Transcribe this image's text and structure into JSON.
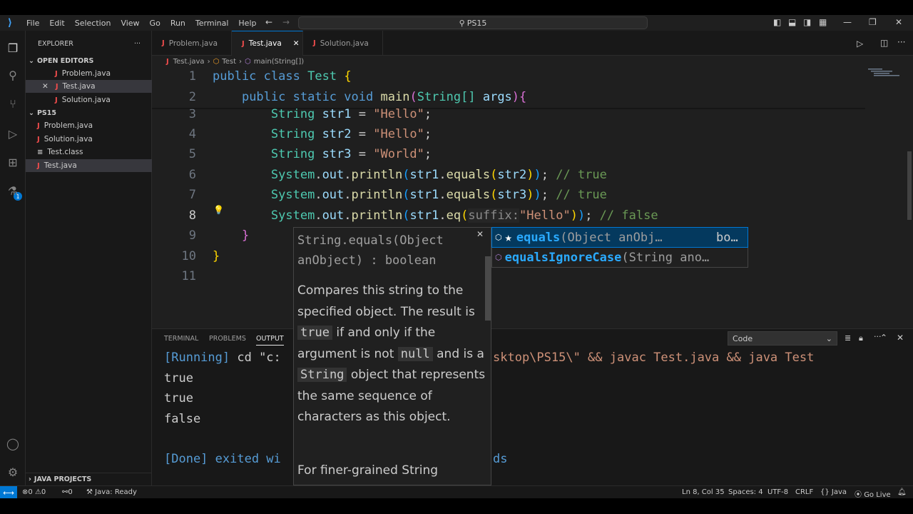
{
  "menu": [
    "File",
    "Edit",
    "Selection",
    "View",
    "Go",
    "Run",
    "Terminal",
    "Help"
  ],
  "search": {
    "label": "PS15"
  },
  "sidebar": {
    "title": "EXPLORER",
    "open_editors_label": "OPEN EDITORS",
    "open_editors": [
      "Problem.java",
      "Test.java",
      "Solution.java"
    ],
    "folder_label": "PS15",
    "files": [
      "Problem.java",
      "Solution.java",
      "Test.class",
      "Test.java"
    ],
    "java_projects_label": "JAVA PROJECTS",
    "badge": "1"
  },
  "tabs": [
    "Problem.java",
    "Test.java",
    "Solution.java"
  ],
  "breadcrumb": {
    "file": "Test.java",
    "cls": "Test",
    "method": "main(String[])"
  },
  "line_numbers": [
    "1",
    "2",
    "3",
    "4",
    "5",
    "6",
    "7",
    "8",
    "9",
    "10",
    "11"
  ],
  "code": {
    "l1_kw1": "public",
    "l1_kw2": "class",
    "l1_cls": "Test",
    "l1_br": "{",
    "l2_kw1": "public",
    "l2_kw2": "static",
    "l2_kw3": "void",
    "l2_fn": "main",
    "l2_type": "String[]",
    "l2_arg": "args",
    "l3_type": "String",
    "l3_var": "str1",
    "l3_val": "\"Hello\"",
    "l4_type": "String",
    "l4_var": "str2",
    "l4_val": "\"Hello\"",
    "l5_type": "String",
    "l5_var": "str3",
    "l5_val": "\"World\"",
    "sys": "System",
    "out": "out",
    "println": "println",
    "equals": "equals",
    "l6_a": "str1",
    "l6_b": "str2",
    "l6_cm": "// true",
    "l7_a": "str1",
    "l7_b": "str3",
    "l7_cm": "// true",
    "l8_a": "str1",
    "l8_eq": "eq",
    "l8_hint": "suffix:",
    "l8_val": "\"Hello\"",
    "l8_cm": "// false"
  },
  "panel": {
    "tabs": [
      "TERMINAL",
      "PROBLEMS",
      "OUTPUT"
    ],
    "select": "Code",
    "line1_run": "[Running]",
    "line1_left": " cd \"c:",
    "line1_right": "sktop\\PS15\\\" && javac Test.java && java Test",
    "out1": "true",
    "out2": "true",
    "out3": "false",
    "done_left": "[Done] exited wi",
    "done_right": "ds"
  },
  "hover": {
    "sig1": "String.equals(Object",
    "sig2": "anObject) : boolean",
    "d1": "Compares this string to the specified object. The result is",
    "true": "true",
    "d2": "if and only if the argument is not",
    "null": "null",
    "d3": "and is a",
    "string": "String",
    "d4": "object that represents the same sequence of characters as this object.",
    "more": "For finer-grained String"
  },
  "suggest": [
    {
      "star": "★",
      "match": "equals",
      "detail": "(Object anObj…",
      "type": "bo…"
    },
    {
      "match": "equalsIgnoreCase",
      "detail": "(String ano…",
      "type": ""
    }
  ],
  "status": {
    "errors": "0",
    "warnings": "0",
    "ports": "0",
    "java": "Java: Ready",
    "position": "Ln 8, Col 35",
    "spaces": "Spaces: 4",
    "encoding": "UTF-8",
    "eol": "CRLF",
    "lang": "Java",
    "golive": "Go Live"
  },
  "colors": {
    "accent": "#0078d4",
    "keyword": "#569cd6",
    "string": "#ce9178",
    "comment": "#6a9955"
  }
}
